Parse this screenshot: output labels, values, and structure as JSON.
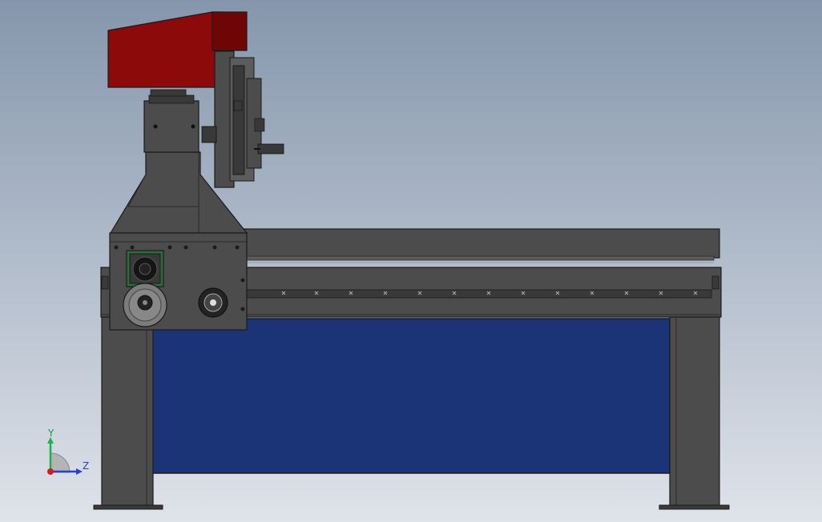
{
  "viewport": {
    "background_top": "#8596ac",
    "background_bottom": "#dfe3ea"
  },
  "colors": {
    "frame": "#4c4c4c",
    "frame_dark": "#393939",
    "frame_light": "#5c5c5c",
    "outline": "#1a1a1a",
    "red_cover": "#8c0a0a",
    "red_cover_side": "#6e0606",
    "blue_panel": "#1b3478",
    "pcb_green": "#2f6a3c",
    "y_axis": "#22b04a",
    "z_axis": "#2a40c8",
    "origin": "#d41c1c"
  },
  "triad": {
    "y_label": "Y",
    "z_label": "Z",
    "icon": "view-orientation-triad-icon"
  }
}
